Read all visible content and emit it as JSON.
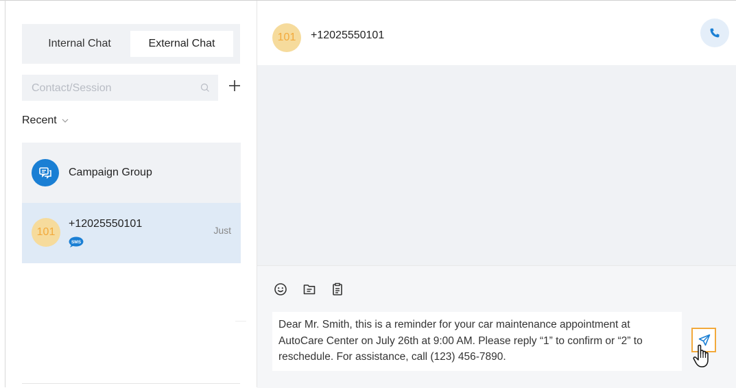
{
  "sidebar": {
    "tabs": {
      "internal": "Internal Chat",
      "external": "External Chat",
      "active": "External Chat"
    },
    "search": {
      "placeholder": "Contact/Session",
      "value": ""
    },
    "recent_label": "Recent",
    "conversations": [
      {
        "name": "Campaign Group",
        "icon": "group-chat-icon",
        "time": ""
      },
      {
        "avatar": "101",
        "name": "+12025550101",
        "channel_icon": "sms-icon",
        "time": "Just",
        "selected": true
      }
    ]
  },
  "chat": {
    "avatar": "101",
    "title": "+12025550101",
    "call_icon": "phone-icon",
    "toolbar_icons": [
      "emoji-icon",
      "file-icon",
      "template-icon"
    ],
    "message_draft": "Dear Mr. Smith, this is a reminder for your car maintenance appointment at\nAutoCare Center on July 26th at 9:00 AM. Please reply “1” to confirm or “2” to\nreschedule. For assistance, call (123) 456-7890.",
    "send_icon": "send-icon"
  },
  "colors": {
    "accent": "#1a7fd4",
    "avatar_bg": "#f6db9c",
    "avatar_text": "#f2a93b",
    "selected_row": "#dfeaf6",
    "panel_bg": "#f0f2f5",
    "send_highlight": "#f2a93b"
  }
}
